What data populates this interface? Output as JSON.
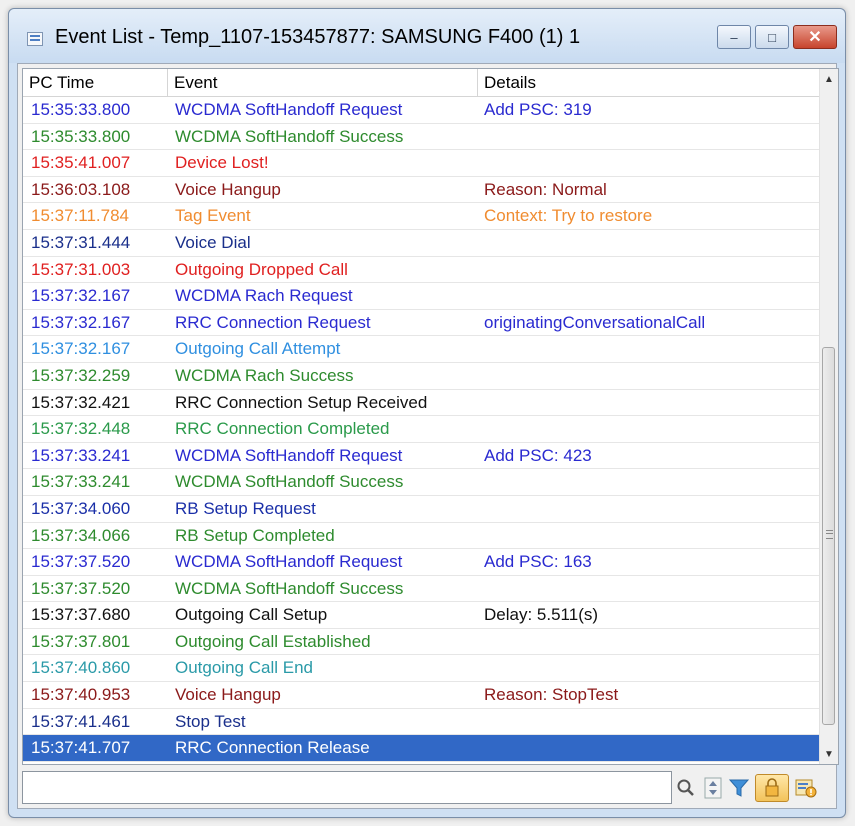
{
  "window": {
    "title": "Event List - Temp_1107-153457877: SAMSUNG F400 (1) 1",
    "controls": {
      "minimize": "–",
      "maximize": "□",
      "close": "✕"
    }
  },
  "columns": [
    {
      "label": "PC Time"
    },
    {
      "label": "Event"
    },
    {
      "label": "Details"
    }
  ],
  "rows": [
    {
      "time": "15:35:33.800",
      "event": "WCDMA SoftHandoff Request",
      "details": "Add PSC: 319",
      "color": "#2a2ad0"
    },
    {
      "time": "15:35:33.800",
      "event": "WCDMA SoftHandoff Success",
      "details": "",
      "color": "#2e8b2e"
    },
    {
      "time": "15:35:41.007",
      "event": "Device Lost!",
      "details": "",
      "color": "#e02020"
    },
    {
      "time": "15:36:03.108",
      "event": "Voice Hangup",
      "details": "Reason: Normal",
      "color": "#8b1a1a"
    },
    {
      "time": "15:37:11.784",
      "event": "Tag Event",
      "details": "Context: Try to restore",
      "color": "#f08c30"
    },
    {
      "time": "15:37:31.444",
      "event": "Voice Dial",
      "details": "",
      "color": "#1a2f8b"
    },
    {
      "time": "15:37:31.003",
      "event": "Outgoing Dropped Call",
      "details": "",
      "color": "#e02020"
    },
    {
      "time": "15:37:32.167",
      "event": "WCDMA Rach Request",
      "details": "",
      "color": "#2a2ad0"
    },
    {
      "time": "15:37:32.167",
      "event": "RRC Connection Request",
      "details": "originatingConversationalCall",
      "color": "#2a2ad0"
    },
    {
      "time": "15:37:32.167",
      "event": "Outgoing Call Attempt",
      "details": "",
      "color": "#2f8fe0"
    },
    {
      "time": "15:37:32.259",
      "event": "WCDMA Rach Success",
      "details": "",
      "color": "#2e8b2e"
    },
    {
      "time": "15:37:32.421",
      "event": "RRC Connection Setup Received",
      "details": "",
      "color": "#111111"
    },
    {
      "time": "15:37:32.448",
      "event": "RRC Connection Completed",
      "details": "",
      "color": "#2a9a4a"
    },
    {
      "time": "15:37:33.241",
      "event": "WCDMA SoftHandoff Request",
      "details": "Add PSC: 423",
      "color": "#2a2ad0"
    },
    {
      "time": "15:37:33.241",
      "event": "WCDMA SoftHandoff Success",
      "details": "",
      "color": "#2e8b2e"
    },
    {
      "time": "15:37:34.060",
      "event": "RB Setup Request",
      "details": "",
      "color": "#1a2fa8"
    },
    {
      "time": "15:37:34.066",
      "event": "RB Setup Completed",
      "details": "",
      "color": "#2e8b2e"
    },
    {
      "time": "15:37:37.520",
      "event": "WCDMA SoftHandoff Request",
      "details": "Add PSC: 163",
      "color": "#2a2ad0"
    },
    {
      "time": "15:37:37.520",
      "event": "WCDMA SoftHandoff Success",
      "details": "",
      "color": "#2e8b2e"
    },
    {
      "time": "15:37:37.680",
      "event": "Outgoing Call Setup",
      "details": "Delay: 5.511(s)",
      "color": "#111111"
    },
    {
      "time": "15:37:37.801",
      "event": "Outgoing Call Established",
      "details": "",
      "color": "#2e8b2e"
    },
    {
      "time": "15:37:40.860",
      "event": "Outgoing Call End",
      "details": "",
      "color": "#2a9aa8"
    },
    {
      "time": "15:37:40.953",
      "event": "Voice Hangup",
      "details": "Reason: StopTest",
      "color": "#8b1a1a"
    },
    {
      "time": "15:37:41.461",
      "event": "Stop Test",
      "details": "",
      "color": "#1a2f8b"
    },
    {
      "time": "15:37:41.707",
      "event": "RRC Connection Release",
      "details": "",
      "color": "#ffffff",
      "selected": true
    }
  ],
  "filter": {
    "value": "",
    "placeholder": ""
  },
  "toolbar_icons": [
    "search-icon",
    "stepper-icon",
    "funnel-icon",
    "lock-icon",
    "info-icon"
  ],
  "colors": {
    "selection": "#3168c6",
    "title_bg": "#cfe0f3"
  }
}
